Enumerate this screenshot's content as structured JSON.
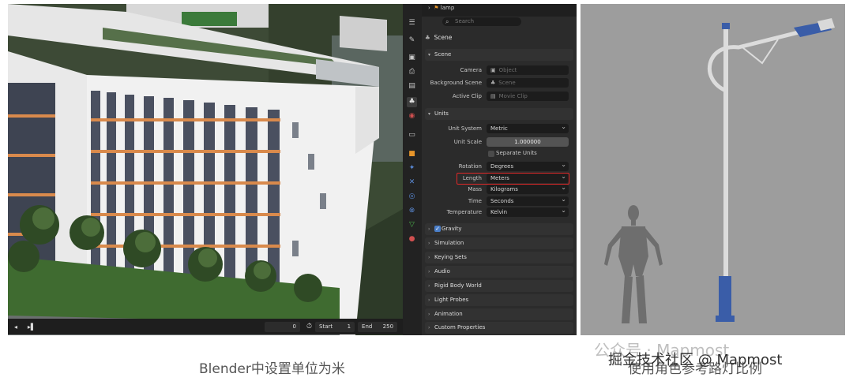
{
  "viewport": {
    "timeline": {
      "play_icon": "play-icon",
      "current_frame": "0",
      "start_label": "Start",
      "start_value": "1",
      "end_label": "End",
      "end_value": "250"
    }
  },
  "properties": {
    "breadcrumb": "lamp",
    "search_placeholder": "Search",
    "context_title": "Scene",
    "panels": {
      "scene": {
        "title": "Scene",
        "camera_label": "Camera",
        "camera_placeholder": "Object",
        "background_label": "Background Scene",
        "background_placeholder": "Scene",
        "clip_label": "Active Clip",
        "clip_placeholder": "Movie Clip"
      },
      "units": {
        "title": "Units",
        "unit_system_label": "Unit System",
        "unit_system_value": "Metric",
        "unit_scale_label": "Unit Scale",
        "unit_scale_value": "1.000000",
        "separate_units_label": "Separate Units",
        "rotation_label": "Rotation",
        "rotation_value": "Degrees",
        "length_label": "Length",
        "length_value": "Meters",
        "mass_label": "Mass",
        "mass_value": "Kilograms",
        "time_label": "Time",
        "time_value": "Seconds",
        "temperature_label": "Temperature",
        "temperature_value": "Kelvin"
      },
      "collapsed": [
        "Gravity",
        "Simulation",
        "Keying Sets",
        "Audio",
        "Rigid Body World",
        "Light Probes",
        "Animation",
        "Custom Properties"
      ]
    },
    "accent_color": "#4a7ec8",
    "highlight_color": "#e02828"
  },
  "captions": {
    "left": "Blender中设置单位为米",
    "right": "使用角色参考路灯比例"
  },
  "watermark": {
    "line1": "公众号 · Mapmost",
    "line2": "掘金技术社区 @ Mapmost"
  }
}
